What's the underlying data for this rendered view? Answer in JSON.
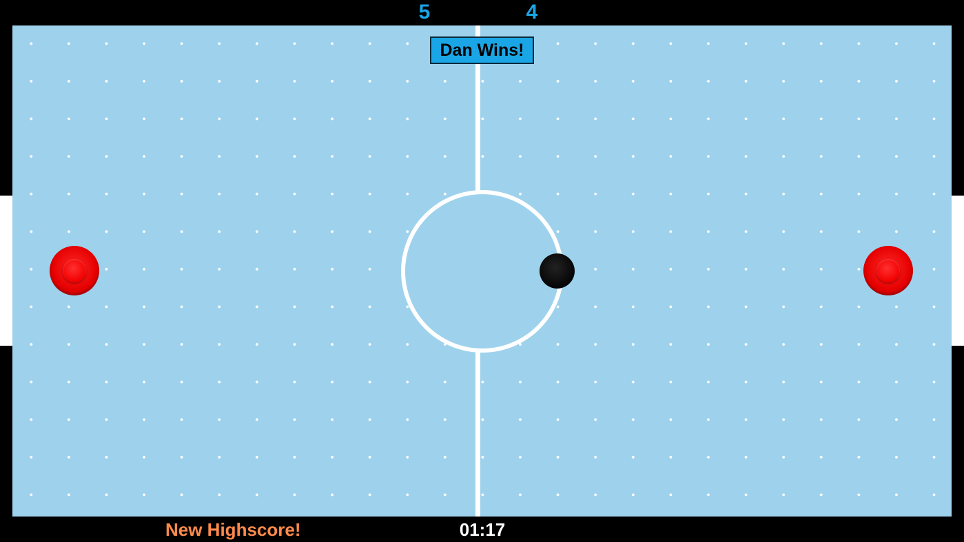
{
  "scores": {
    "left": "5",
    "right": "4"
  },
  "banner": {
    "winner_text": "Dan Wins!"
  },
  "footer": {
    "highscore_text": "New Highscore!",
    "timer": "01:17"
  },
  "icons": {
    "left_paddle": "red-mallet-icon",
    "right_paddle": "red-mallet-icon",
    "puck": "black-puck-icon"
  },
  "colors": {
    "rink": "#9ed2ec",
    "score": "#1aa6e6",
    "banner_bg": "#1aa6e6",
    "highscore": "#ff8a4c",
    "paddle": "#e60000",
    "puck": "#000000",
    "background": "#000000"
  }
}
